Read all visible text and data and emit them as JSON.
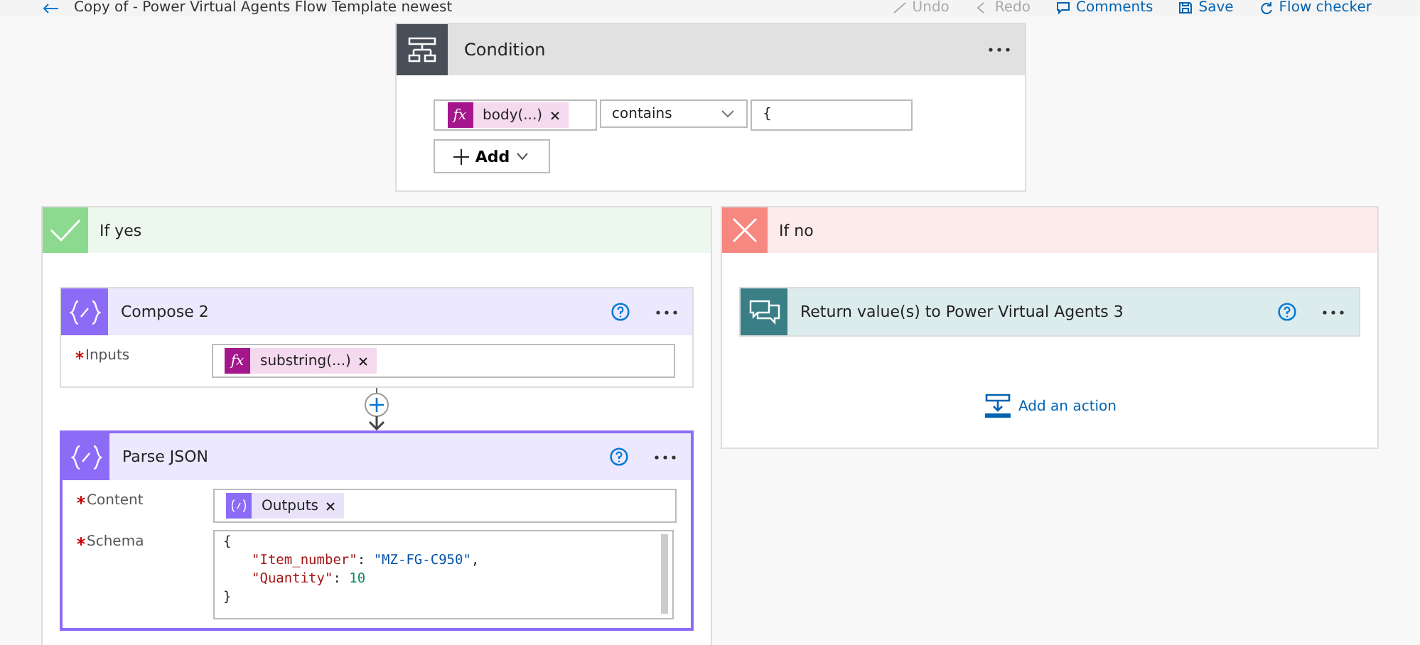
{
  "header": {
    "title": "Copy of - Power Virtual Agents Flow Template newest",
    "actions": [
      {
        "label": "Undo",
        "disabled": true,
        "kind": "undo"
      },
      {
        "label": "Redo",
        "disabled": true,
        "kind": "redo"
      },
      {
        "label": "Comments",
        "disabled": false,
        "kind": "comments"
      },
      {
        "label": "Save",
        "disabled": false,
        "kind": "save"
      },
      {
        "label": "Flow checker",
        "disabled": false,
        "kind": "checker"
      }
    ]
  },
  "condition": {
    "title": "Condition",
    "token_badge": "fx",
    "token": "body(...)",
    "operator": "contains",
    "value": "{",
    "add_label": "Add"
  },
  "yes_branch": {
    "title": "If yes",
    "actions": [
      {
        "title": "Compose 2",
        "kind": "compose",
        "selected": false,
        "fields": [
          {
            "label": "Inputs",
            "required": true,
            "kind": "token",
            "token": {
              "kind": "expression",
              "badge": "fx",
              "text": "substring(...)"
            }
          }
        ]
      },
      {
        "title": "Parse JSON",
        "kind": "compose",
        "selected": true,
        "fields": [
          {
            "label": "Content",
            "required": true,
            "kind": "token",
            "token": {
              "kind": "variable",
              "text": "Outputs"
            }
          },
          {
            "label": "Schema",
            "required": true,
            "kind": "code",
            "lines": [
              [
                {
                  "kind": "punct",
                  "text": "{"
                }
              ],
              [
                {
                  "kind": "key",
                  "text": "\"Item_number\""
                },
                {
                  "kind": "punct",
                  "text": ": "
                },
                {
                  "kind": "string",
                  "text": "\"MZ-FG-C950\""
                },
                {
                  "kind": "punct",
                  "text": ","
                }
              ],
              [
                {
                  "kind": "key",
                  "text": "\"Quantity\""
                },
                {
                  "kind": "punct",
                  "text": ": "
                },
                {
                  "kind": "number",
                  "text": "10"
                }
              ],
              [
                {
                  "kind": "punct",
                  "text": "}"
                }
              ]
            ]
          }
        ]
      }
    ]
  },
  "no_branch": {
    "title": "If no",
    "actions": [
      {
        "title": "Return value(s) to Power Virtual Agents 3",
        "kind": "pva",
        "selected": false
      }
    ],
    "add_action": "Add an action"
  }
}
